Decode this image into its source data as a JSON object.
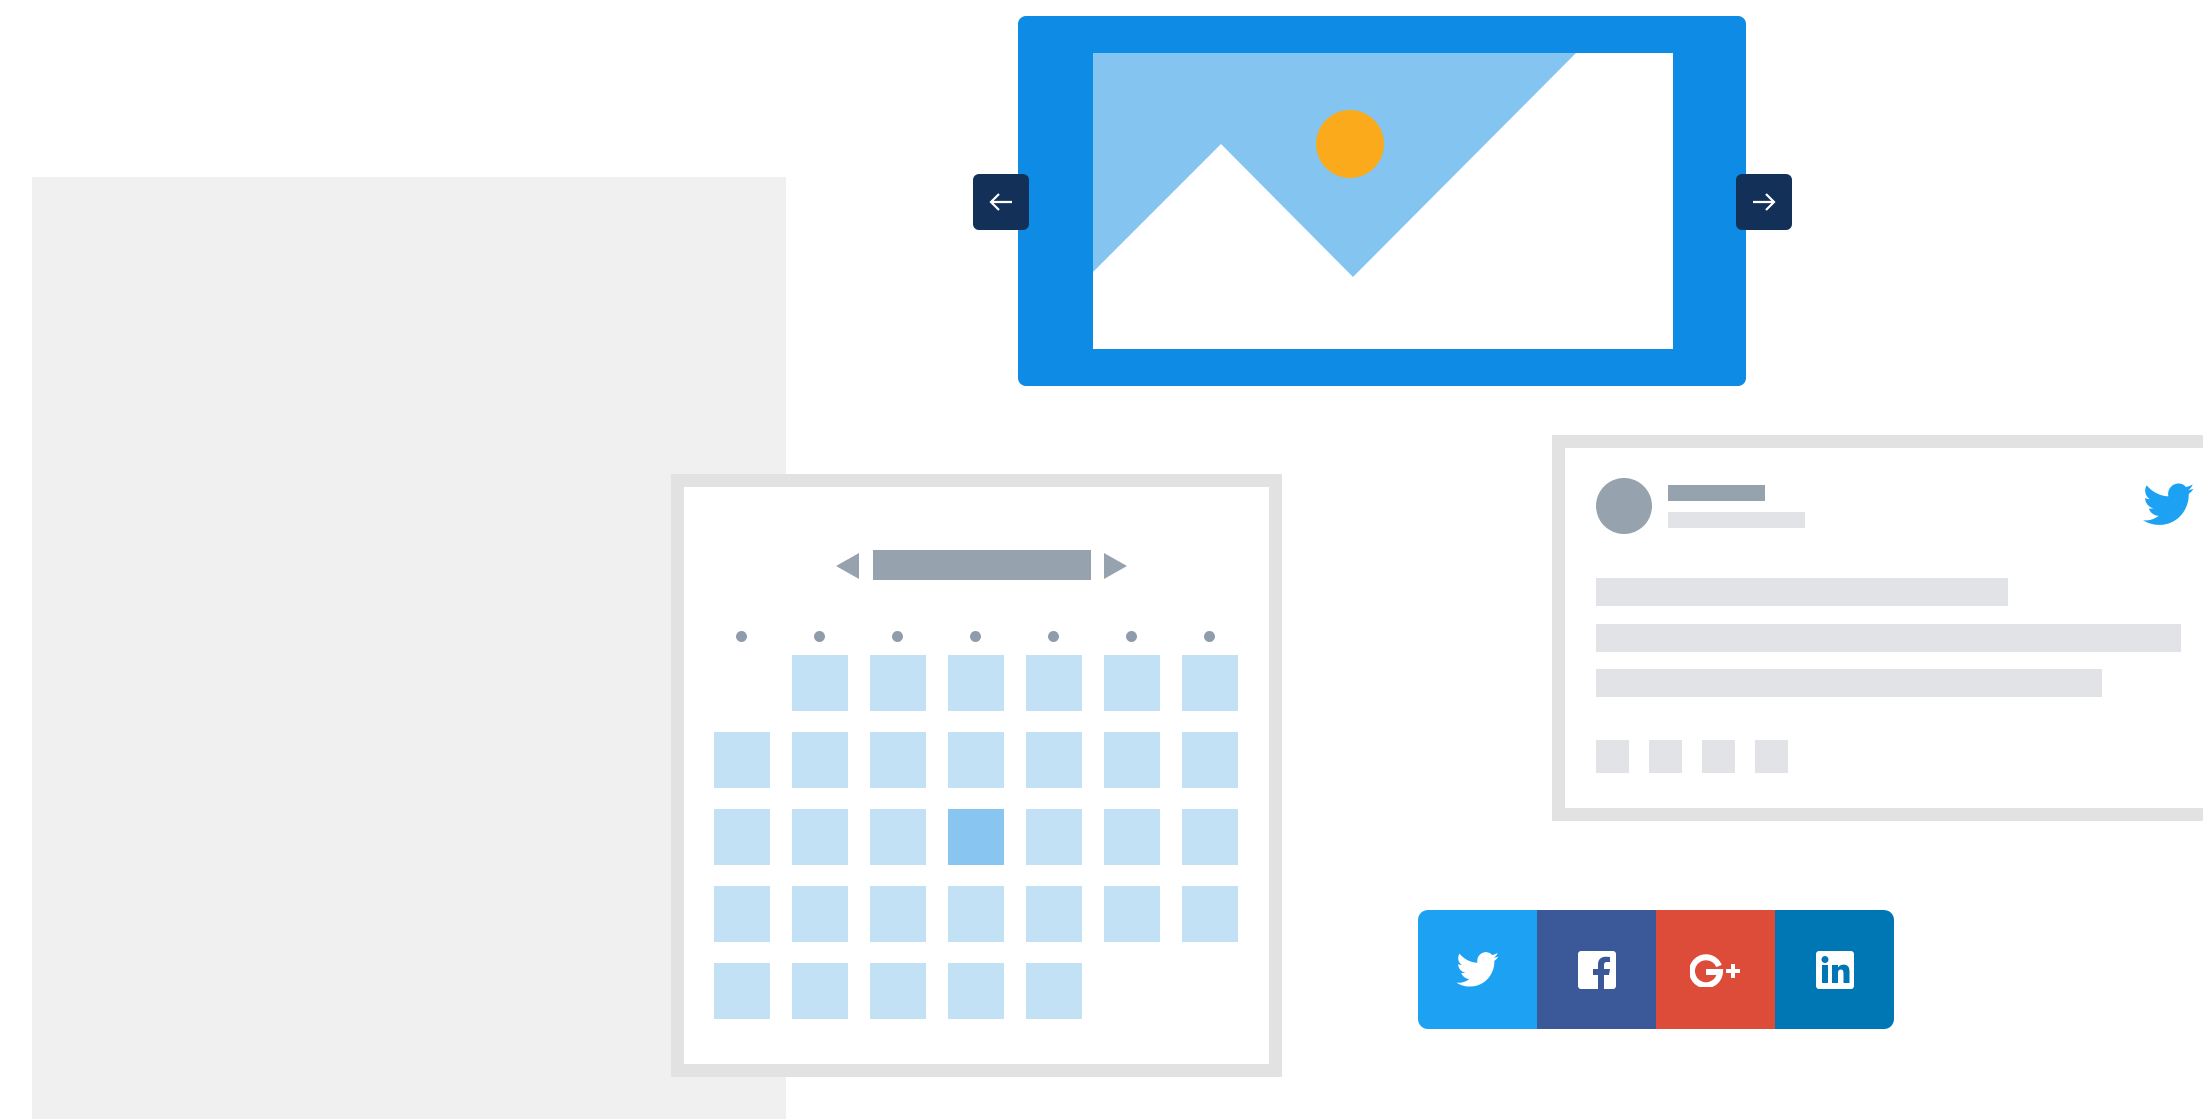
{
  "colors": {
    "background_panel": "#f0f0f0",
    "slider_frame": "#0e8be5",
    "slider_sky": "#84c4f1",
    "sun": "#fbaa1b",
    "nav_button": "#123058",
    "calendar_border": "#e2e2e2",
    "calendar_cell": "#c2e1f5",
    "calendar_cell_selected": "#88c5f0",
    "placeholder_dark": "#96a2ae",
    "placeholder_light": "#e2e3e7",
    "twitter": "#1da1f2",
    "facebook": "#3b5998",
    "google_plus": "#dd4b39",
    "linkedin": "#0077b5"
  },
  "slider": {
    "prev_icon": "arrow-left-icon",
    "next_icon": "arrow-right-icon",
    "image_icon": "image-placeholder-icon"
  },
  "calendar": {
    "prev_icon": "triangle-left-icon",
    "next_icon": "triangle-right-icon",
    "weekday_count": 7,
    "day_count": 32,
    "selected_day_index": 16
  },
  "tweet": {
    "brand_icon": "twitter-bird-icon",
    "text_lines": 3,
    "action_count": 4
  },
  "share_buttons": [
    {
      "network": "twitter",
      "icon": "twitter-icon",
      "color": "#1da1f2"
    },
    {
      "network": "facebook",
      "icon": "facebook-icon",
      "color": "#3b5998"
    },
    {
      "network": "google-plus",
      "icon": "google-plus-icon",
      "color": "#dd4b39"
    },
    {
      "network": "linkedin",
      "icon": "linkedin-icon",
      "color": "#0077b5"
    }
  ]
}
